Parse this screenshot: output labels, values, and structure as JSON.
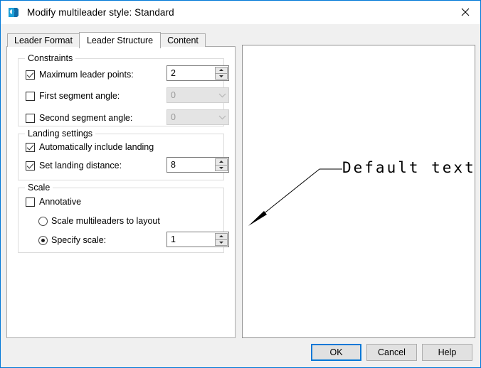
{
  "window": {
    "title": "Modify multileader style: Standard",
    "app_icon": "autocad-icon",
    "close_label": "✕",
    "accent_color": "#0078d7"
  },
  "tabs": [
    {
      "label": "Leader Format",
      "active": false
    },
    {
      "label": "Leader Structure",
      "active": true
    },
    {
      "label": "Content",
      "active": false
    }
  ],
  "constraints": {
    "group_title": "Constraints",
    "max_leader_points": {
      "label": "Maximum leader points:",
      "checked": true,
      "value": "2"
    },
    "first_segment_angle": {
      "label": "First segment angle:",
      "checked": false,
      "value": "0",
      "enabled": false
    },
    "second_segment_angle": {
      "label": "Second segment angle:",
      "checked": false,
      "value": "0",
      "enabled": false
    }
  },
  "landing": {
    "group_title": "Landing settings",
    "auto_include": {
      "label": "Automatically include landing",
      "checked": true
    },
    "set_distance": {
      "label": "Set landing distance:",
      "checked": true,
      "value": "8"
    }
  },
  "scale": {
    "group_title": "Scale",
    "annotative": {
      "label": "Annotative",
      "checked": false
    },
    "scale_to_layout": {
      "label": "Scale multileaders to layout",
      "selected": false
    },
    "specify_scale": {
      "label": "Specify scale:",
      "selected": true,
      "value": "1"
    }
  },
  "preview": {
    "text": "Default text"
  },
  "footer": {
    "ok_label": "OK",
    "cancel_label": "Cancel",
    "help_label": "Help"
  }
}
